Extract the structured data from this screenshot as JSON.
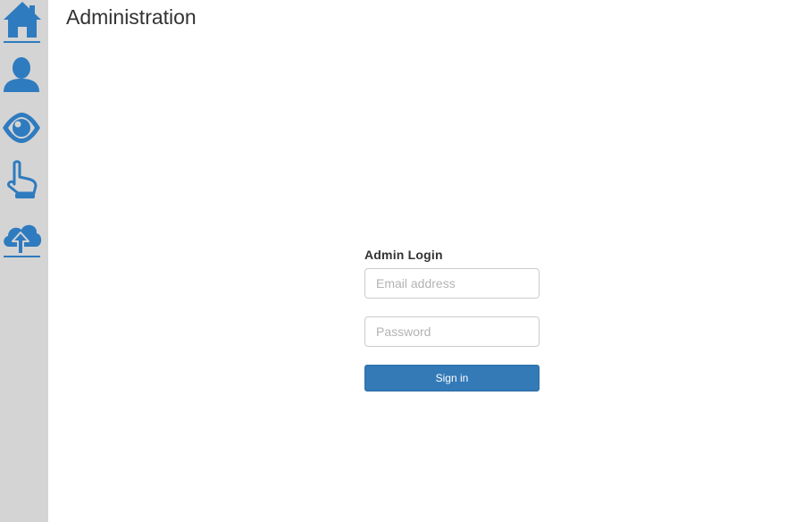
{
  "header": {
    "title": "Administration"
  },
  "sidebar": {
    "items": [
      {
        "icon": "home-icon",
        "active": true
      },
      {
        "icon": "user-icon"
      },
      {
        "icon": "eye-icon"
      },
      {
        "icon": "hand-pointer-icon"
      },
      {
        "icon": "cloud-upload-icon"
      }
    ]
  },
  "login": {
    "heading": "Admin Login",
    "email_placeholder": "Email address",
    "email_value": "",
    "password_placeholder": "Password",
    "password_value": "",
    "submit_label": "Sign in"
  },
  "colors": {
    "accent": "#337ab7",
    "sidebar_bg": "#d4d4d4",
    "icon": "#2f7bbf"
  }
}
